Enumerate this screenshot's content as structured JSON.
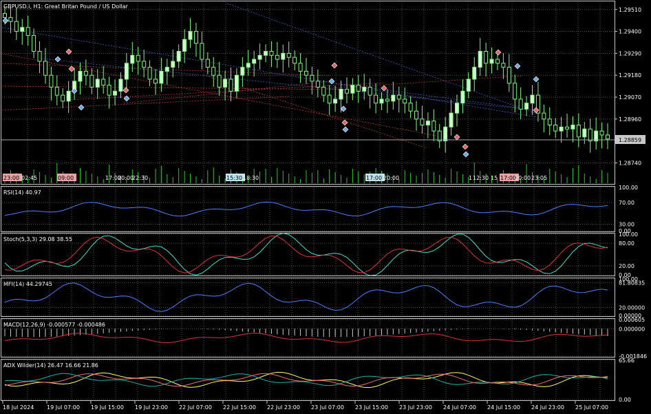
{
  "chart_data": {
    "type": "candlestick",
    "symbol_title": "GBPUSD.i, H1:  Great Britan Pound / US Dollar",
    "current_price": "1.28859",
    "price_axis": [
      "1.29510",
      "1.29400",
      "1.29290",
      "1.29180",
      "1.29070",
      "1.28960",
      "1.28740"
    ],
    "price_range": [
      1.287,
      1.2953
    ],
    "time_axis": [
      "18 Jul 2024",
      "19 Jul 07:00",
      "19 Jul 15:00",
      "19 Jul 23:00",
      "22 Jul 07:00",
      "22 Jul 15:00",
      "22 Jul 23:00",
      "23 Jul 07:00",
      "23 Jul 15:00",
      "23 Jul 23:00",
      "24 Jul 07:00",
      "24 Jul 15:00",
      "24 Jul 23:00",
      "25 Jul 07:00"
    ],
    "session_marks": [
      {
        "text": "23:00",
        "color": "#e8a3a3"
      },
      {
        "text": "02:45",
        "color": "#ffffff"
      },
      {
        "text": "09:00",
        "color": "#e8a3a3"
      },
      {
        "text": "17:00",
        "color": "#ffffff"
      },
      {
        "text": "20:00",
        "color": "#ffffff"
      },
      {
        "text": "22:30",
        "color": "#ffffff"
      },
      {
        "text": "15:30",
        "color": "#bde3ef"
      },
      {
        "text": "18:30",
        "color": "#ffffff"
      },
      {
        "text": "17:00",
        "color": "#bde3ef"
      },
      {
        "text": "20:00",
        "color": "#ffffff"
      },
      {
        "text": "1",
        "color": "#ffffff"
      },
      {
        "text": "12:30",
        "color": "#ffffff"
      },
      {
        "text": "15",
        "color": "#ffffff"
      },
      {
        "text": "17:00",
        "color": "#e8a3a3"
      },
      {
        "text": "20:00",
        "color": "#ffffff"
      },
      {
        "text": "23:05",
        "color": "#ffffff"
      }
    ],
    "closes": [
      1.2947,
      1.2945,
      1.294,
      1.2942,
      1.2938,
      1.293,
      1.2925,
      1.2918,
      1.2912,
      1.2908,
      1.2905,
      1.291,
      1.2915,
      1.292,
      1.2918,
      1.2912,
      1.2916,
      1.2913,
      1.2908,
      1.291,
      1.2916,
      1.2924,
      1.2928,
      1.2925,
      1.2922,
      1.2916,
      1.2914,
      1.292,
      1.2922,
      1.2925,
      1.293,
      1.2936,
      1.294,
      1.2934,
      1.2926,
      1.2922,
      1.2918,
      1.2912,
      1.2916,
      1.291,
      1.2918,
      1.2922,
      1.2924,
      1.2926,
      1.2928,
      1.293,
      1.2928,
      1.2926,
      1.2929,
      1.2927,
      1.2924,
      1.292,
      1.2918,
      1.2915,
      1.2912,
      1.2908,
      1.2904,
      1.2906,
      1.2911,
      1.2909,
      1.2913,
      1.291,
      1.2912,
      1.2908,
      1.2904,
      1.2906,
      1.2905,
      1.2908,
      1.2906,
      1.2904,
      1.29,
      1.2896,
      1.2893,
      1.2895,
      1.289,
      1.2885,
      1.2892,
      1.2899,
      1.2904,
      1.291,
      1.2916,
      1.2922,
      1.293,
      1.2924,
      1.2926,
      1.2924,
      1.2922,
      1.2914,
      1.2906,
      1.2901,
      1.2904,
      1.2908,
      1.2899,
      1.2896,
      1.2893,
      1.289,
      1.2892,
      1.2891,
      1.2893,
      1.2887,
      1.2891,
      1.2885,
      1.289,
      1.2888,
      1.2886
    ],
    "indicators": [
      {
        "name": "RSI(14)",
        "values_text": "40.97",
        "levels": [
          "100.00",
          "70.00",
          "30.00",
          "0.00"
        ]
      },
      {
        "name": "Stoch(5,3,3)",
        "values_text": "29.08 38.55",
        "levels": [
          "100.00",
          "80.00",
          "20.00",
          "0.00"
        ]
      },
      {
        "name": "MFI(14)",
        "values_text": "44.29745",
        "levels": [
          "100.00",
          "81.80835",
          "20.00000",
          "0.00000"
        ]
      },
      {
        "name": "MACD(12,26,9)",
        "values_text": "-0.000577 -0.000486",
        "levels": [
          "0.000605",
          "0.000000",
          "-0.001846"
        ]
      },
      {
        "name": "ADX Wilder(14)",
        "values_text": "26.47  16.66  21.86",
        "levels": [
          "65.66",
          "0.00"
        ]
      }
    ],
    "colors": {
      "background": "#000000",
      "up_candle": "#ccffcc",
      "down_candle": "#7cfc7c",
      "wick": "#7cfc7c",
      "grid": "#555555",
      "volume": "#22cc22",
      "rsi_line": "#4a7fff",
      "stoch_main": "#40e0d0",
      "stoch_signal": "#dd3333",
      "mfi_line": "#4a7fff",
      "macd_hist": "#cccccc",
      "macd_signal": "#dd3333",
      "adx_main": "#ffff66",
      "adx_plus": "#20b2aa",
      "adx_minus": "#ee7070"
    }
  }
}
